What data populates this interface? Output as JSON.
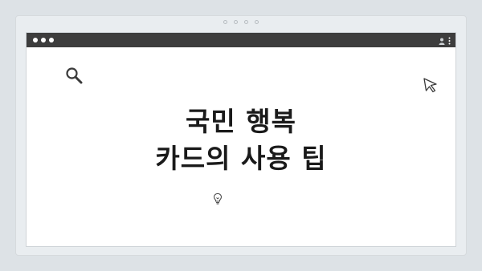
{
  "window": {
    "controls": [
      "close",
      "minimize",
      "maximize"
    ],
    "toolbar_icons": [
      "user-icon",
      "kebab-menu-icon"
    ]
  },
  "page": {
    "heading_line1": "국민 행복",
    "heading_line2": "카드의 사용 팁"
  },
  "decorations": {
    "top_left_icon": "search-icon",
    "top_right_icon": "cursor-icon",
    "bottom_icon": "lightbulb-icon"
  },
  "colors": {
    "background": "#dde2e6",
    "title_bar": "#3d3d3d",
    "heading": "#1a1a1a"
  }
}
